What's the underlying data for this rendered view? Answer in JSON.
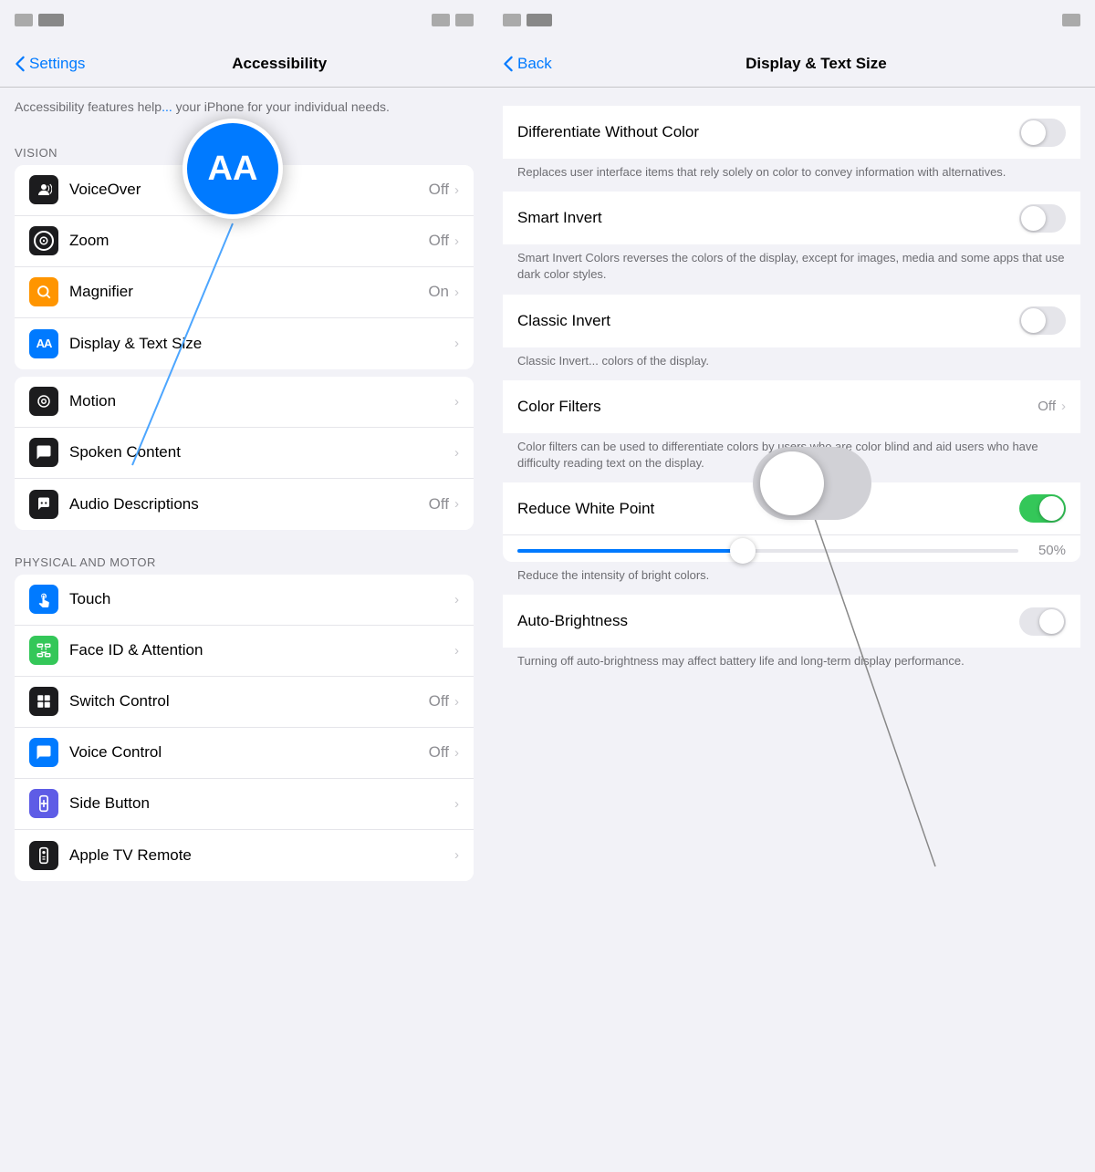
{
  "left": {
    "statusBar": {
      "leftBlocks": [
        "block1",
        "block2"
      ],
      "rightBlocks": [
        "block1",
        "block2"
      ]
    },
    "navBar": {
      "backLabel": "Settings",
      "title": "Accessibility"
    },
    "description": "Accessibility features help... your iPhone for your individual needs.",
    "sections": [
      {
        "header": "VISION",
        "items": [
          {
            "id": "voiceover",
            "iconBg": "icon-dark",
            "iconSymbol": "🔊",
            "label": "VoiceOver",
            "value": "Off",
            "hasChevron": true
          },
          {
            "id": "zoom",
            "iconBg": "icon-dark",
            "iconSymbol": "⊙",
            "label": "Zoom",
            "value": "Off",
            "hasChevron": true
          },
          {
            "id": "magnifier",
            "iconBg": "icon-orange",
            "iconSymbol": "🔍",
            "label": "Magnifier",
            "value": "On",
            "hasChevron": true
          },
          {
            "id": "display-text-size",
            "iconBg": "icon-blue",
            "iconSymbol": "AA",
            "label": "Display & Text Size",
            "value": "",
            "hasChevron": true,
            "highlighted": true
          }
        ]
      },
      {
        "header": "",
        "items": [
          {
            "id": "motion",
            "iconBg": "icon-dark",
            "iconSymbol": "◎",
            "label": "Motion",
            "value": "",
            "hasChevron": true
          },
          {
            "id": "spoken-content",
            "iconBg": "icon-dark",
            "iconSymbol": "💬",
            "label": "Spoken Content",
            "value": "",
            "hasChevron": true
          },
          {
            "id": "audio-descriptions",
            "iconBg": "icon-dark",
            "iconSymbol": "💭",
            "label": "Audio Descriptions",
            "value": "Off",
            "hasChevron": true
          }
        ]
      },
      {
        "header": "PHYSICAL AND MOTOR",
        "items": [
          {
            "id": "touch",
            "iconBg": "icon-blue",
            "iconSymbol": "👆",
            "label": "Touch",
            "value": "",
            "hasChevron": true
          },
          {
            "id": "face-id",
            "iconBg": "icon-green",
            "iconSymbol": "😊",
            "label": "Face ID & Attention",
            "value": "",
            "hasChevron": true
          },
          {
            "id": "switch-control",
            "iconBg": "icon-dark",
            "iconSymbol": "⊞",
            "label": "Switch Control",
            "value": "Off",
            "hasChevron": true
          },
          {
            "id": "voice-control",
            "iconBg": "icon-blue",
            "iconSymbol": "💬",
            "label": "Voice Control",
            "value": "Off",
            "hasChevron": true
          },
          {
            "id": "side-button",
            "iconBg": "icon-gray-blue",
            "iconSymbol": "↩",
            "label": "Side Button",
            "value": "",
            "hasChevron": true
          },
          {
            "id": "apple-tv-remote",
            "iconBg": "icon-dark",
            "iconSymbol": "▶",
            "label": "Apple TV Remote",
            "value": "",
            "hasChevron": true
          }
        ]
      }
    ],
    "aaBubble": {
      "text": "AA"
    }
  },
  "right": {
    "statusBar": {
      "leftBlocks": [
        "block1",
        "block2"
      ],
      "rightBlocks": [
        "block1"
      ]
    },
    "navBar": {
      "backLabel": "Back",
      "title": "Display & Text Size"
    },
    "items": [
      {
        "id": "differentiate-without-color",
        "label": "Differentiate Without Color",
        "description": "Replaces user interface items that rely solely on color to convey information with alternatives.",
        "toggleState": "off"
      },
      {
        "id": "smart-invert",
        "label": "Smart Invert",
        "description": "Smart Invert Colors reverses the colors of the display, except for images, media and some apps that use dark color styles.",
        "toggleState": "off"
      },
      {
        "id": "classic-invert",
        "label": "Classic Invert",
        "description": "Classic Invert... colors of the display.",
        "toggleState": "off"
      },
      {
        "id": "color-filters",
        "label": "Color Filters",
        "value": "Off",
        "hasChevron": true,
        "description": "Color filters can be used to differentiate colors by users who are color blind and aid users who have difficulty reading text on the display."
      },
      {
        "id": "reduce-white-point",
        "label": "Reduce White Point",
        "toggleState": "on",
        "sliderValue": "50%",
        "description": "Reduce the intensity of bright colors."
      },
      {
        "id": "auto-brightness",
        "label": "Auto-Brightness",
        "toggleState": "off-turning",
        "description": "Turning off auto-brightness may affect battery life and long-term display performance."
      }
    ],
    "bigToggle": {
      "visible": true
    }
  }
}
